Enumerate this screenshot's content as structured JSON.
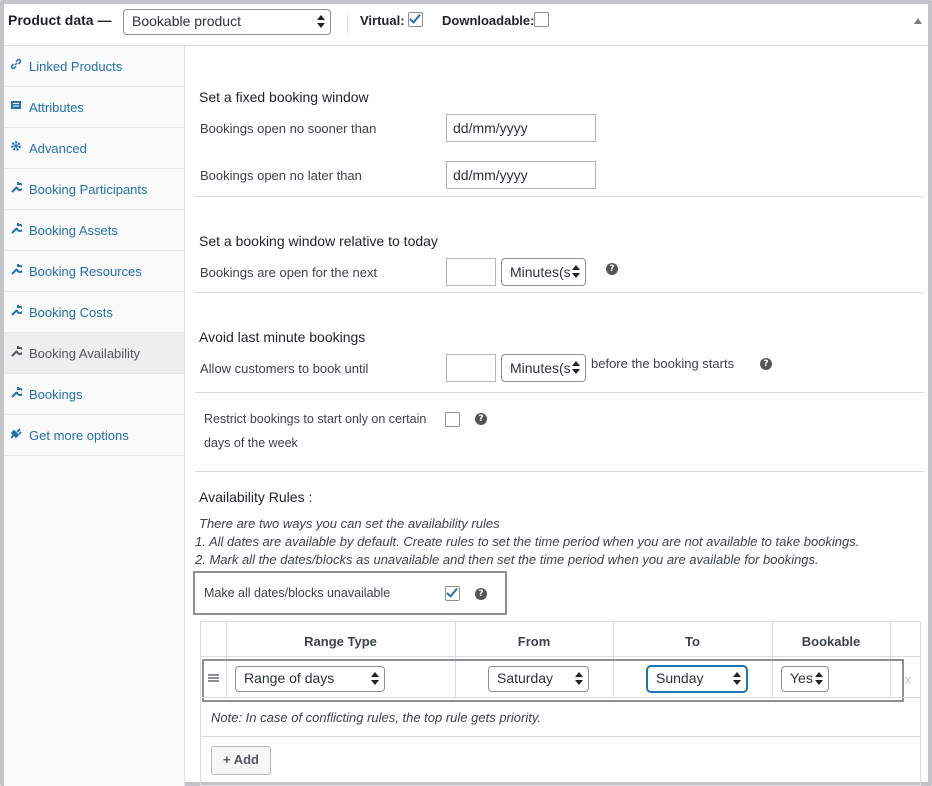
{
  "header": {
    "title": "Product data —",
    "product_type": "Bookable product",
    "virtual_label": "Virtual:",
    "virtual_checked": true,
    "downloadable_label": "Downloadable:",
    "downloadable_checked": false
  },
  "sidebar": {
    "items": [
      {
        "label": "Linked Products",
        "icon": "link-icon"
      },
      {
        "label": "Attributes",
        "icon": "list-icon"
      },
      {
        "label": "Advanced",
        "icon": "gear-icon"
      },
      {
        "label": "Booking Participants",
        "icon": "wrench-icon"
      },
      {
        "label": "Booking Assets",
        "icon": "wrench-icon"
      },
      {
        "label": "Booking Resources",
        "icon": "wrench-icon"
      },
      {
        "label": "Booking Costs",
        "icon": "wrench-icon"
      },
      {
        "label": "Booking Availability",
        "icon": "wrench-icon",
        "active": true
      },
      {
        "label": "Bookings",
        "icon": "wrench-icon"
      },
      {
        "label": "Get more options",
        "icon": "plugin-icon"
      }
    ]
  },
  "fixed_window": {
    "title": "Set a fixed booking window",
    "no_sooner_label": "Bookings open no sooner than",
    "no_sooner_placeholder": "dd/mm/yyyy",
    "no_later_label": "Bookings open no later than",
    "no_later_placeholder": "dd/mm/yyyy"
  },
  "relative_window": {
    "title": "Set a booking window relative to today",
    "label": "Bookings are open for the next",
    "value": "",
    "unit": "Minutes(s"
  },
  "last_minute": {
    "title": "Avoid last minute bookings",
    "label": "Allow customers to book until",
    "value": "",
    "unit": "Minutes(s",
    "suffix": "before the booking starts"
  },
  "restrict_days": {
    "label_line1": "Restrict bookings to start only on certain",
    "label_line2": "days of the week",
    "checked": false
  },
  "availability": {
    "title": "Availability Rules :",
    "intro": "There are two ways you can set the availability rules",
    "rule1": "1. All dates are available by default. Create rules to set the time period when you are not available to take bookings.",
    "rule2": "2. Mark all the dates/blocks as unavailable and then set the time period when you are available for bookings.",
    "make_unavailable_label": "Make all dates/blocks unavailable",
    "make_unavailable_checked": true,
    "columns": [
      "Range Type",
      "From",
      "To",
      "Bookable"
    ],
    "rows": [
      {
        "range_type": "Range of days",
        "from": "Saturday",
        "to": "Sunday",
        "bookable": "Yes",
        "remove": "x"
      }
    ],
    "note": "Note: In case of conflicting rules, the top rule gets priority.",
    "add_button": "+ Add"
  },
  "help_glyph": "?"
}
